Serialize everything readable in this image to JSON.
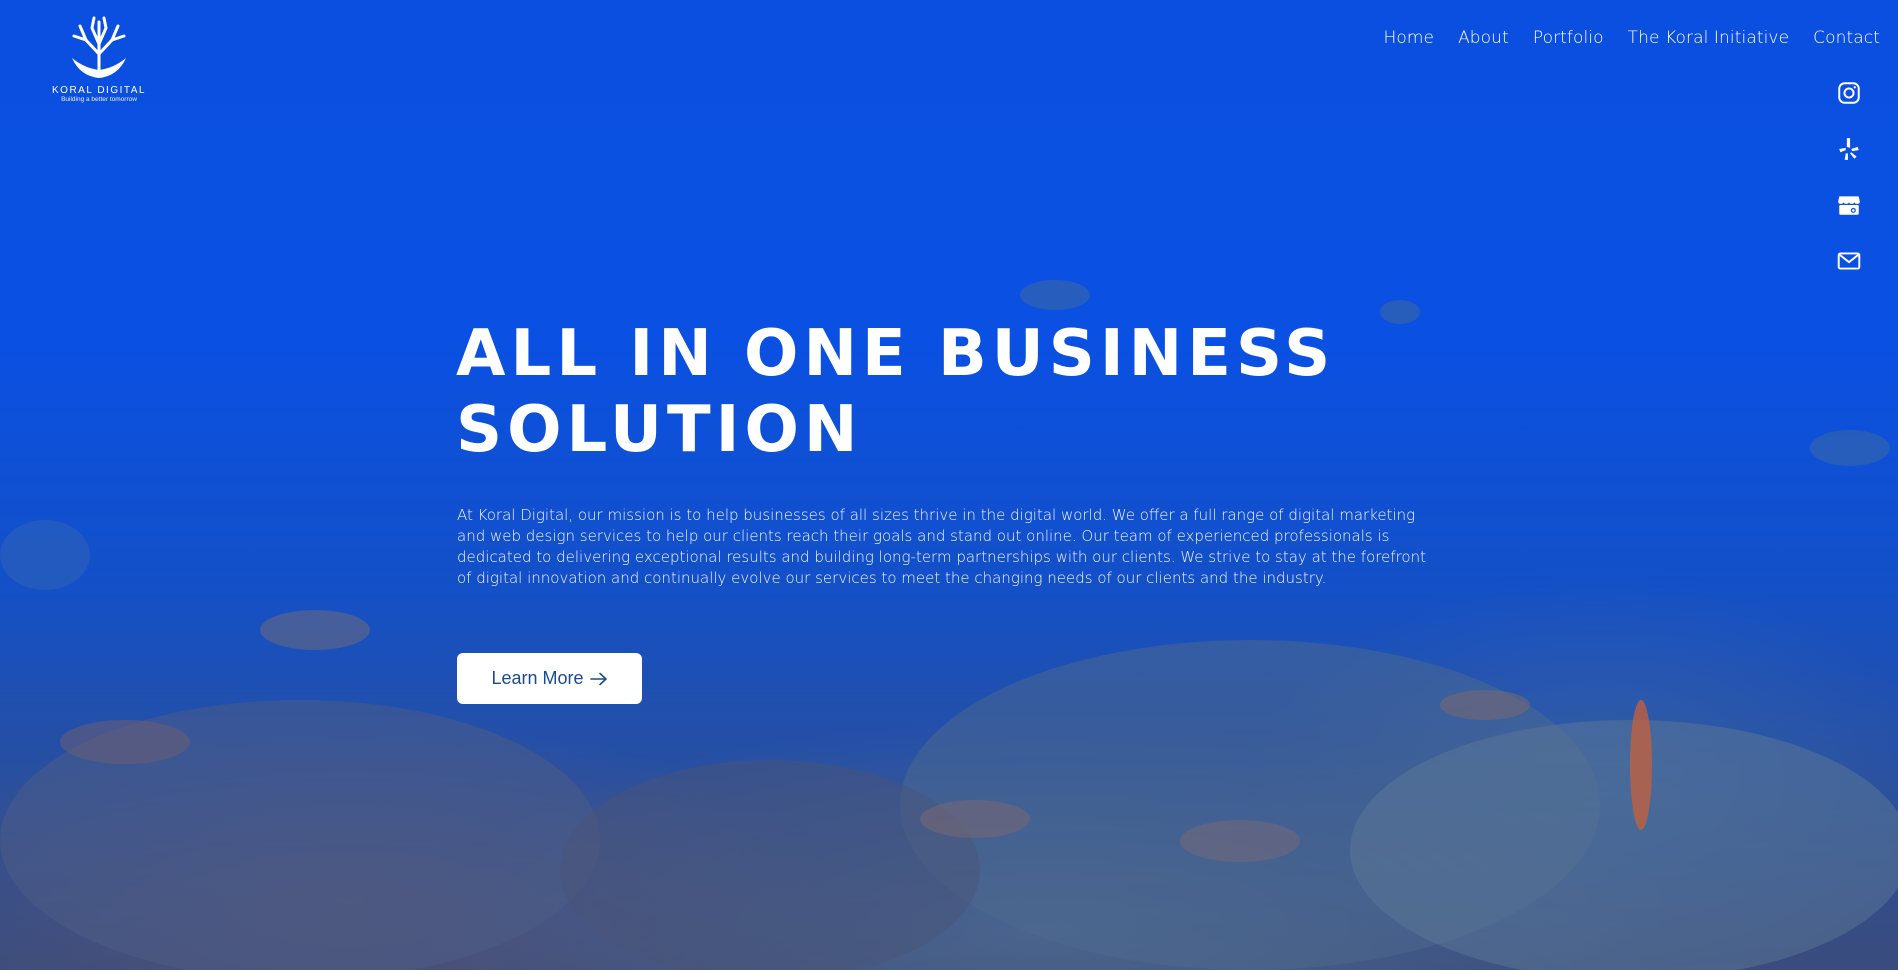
{
  "brand": {
    "name": "KORAL DIGITAL",
    "tagline": "Building a better tomorrow"
  },
  "nav": {
    "items": [
      {
        "label": "Home"
      },
      {
        "label": "About"
      },
      {
        "label": "Portfolio"
      },
      {
        "label": "The Koral Initiative"
      },
      {
        "label": "Contact"
      }
    ]
  },
  "social": {
    "icons": [
      "instagram-icon",
      "yelp-icon",
      "google-business-icon",
      "email-icon"
    ]
  },
  "hero": {
    "title_line1": "ALL IN ONE BUSINESS",
    "title_line2": "SOLUTION",
    "description": "At Koral Digital, our mission is to help businesses of all sizes thrive in the digital world. We offer a full range of digital marketing and web design services to help our clients reach their goals and stand out online. Our team of experienced professionals is dedicated to delivering exceptional results and building long-term partnerships with our clients. We strive to stay at the forefront of digital innovation and continually evolve our services to meet the changing needs of our clients and the industry.",
    "cta_label": "Learn More",
    "cta_icon": "arrow-right-icon"
  },
  "colors": {
    "water_top": "#0a4fe0",
    "water_bottom": "#3a4c7c",
    "cta_text": "#1a4b8f",
    "white": "#ffffff"
  }
}
